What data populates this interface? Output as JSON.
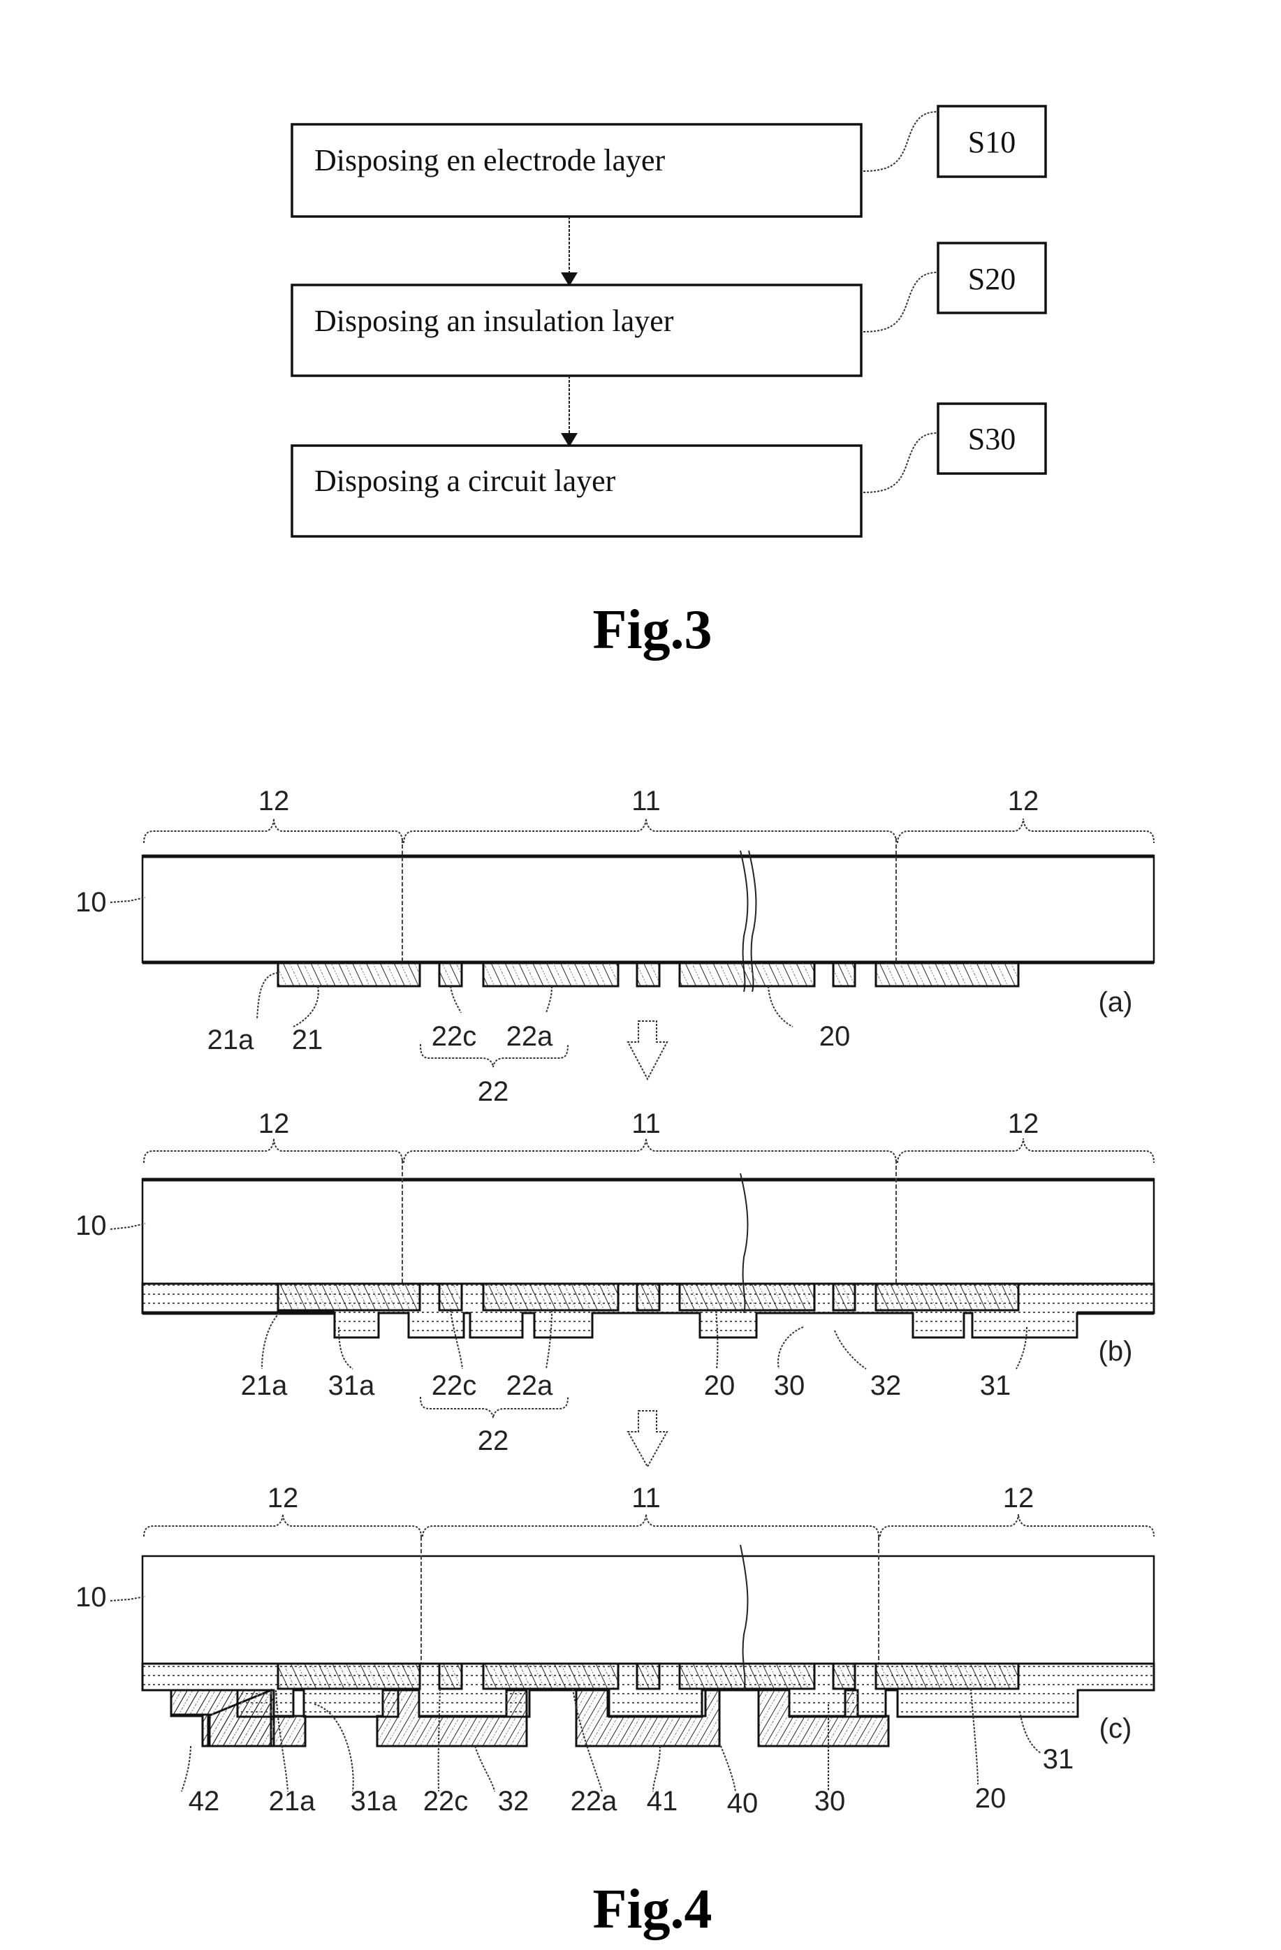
{
  "fig3": {
    "caption": "Fig.3",
    "steps": [
      {
        "text": "Disposing en electrode layer",
        "label": "S10"
      },
      {
        "text": "Disposing an insulation layer",
        "label": "S20"
      },
      {
        "text": "Disposing a circuit layer",
        "label": "S30"
      }
    ]
  },
  "fig4": {
    "caption": "Fig.4",
    "panels": [
      {
        "tag": "(a)",
        "regions": [
          "12",
          "11",
          "12"
        ],
        "substrate_label": "10",
        "refs": [
          "21a",
          "21",
          "22c",
          "22a",
          "20",
          "22"
        ]
      },
      {
        "tag": "(b)",
        "regions": [
          "12",
          "11",
          "12"
        ],
        "substrate_label": "10",
        "refs": [
          "21a",
          "31a",
          "22c",
          "22a",
          "20",
          "30",
          "32",
          "31",
          "22"
        ]
      },
      {
        "tag": "(c)",
        "regions": [
          "12",
          "11",
          "12"
        ],
        "substrate_label": "10",
        "refs": [
          "42",
          "21a",
          "31a",
          "22c",
          "32",
          "22a",
          "41",
          "40",
          "30",
          "20",
          "31"
        ]
      }
    ]
  }
}
